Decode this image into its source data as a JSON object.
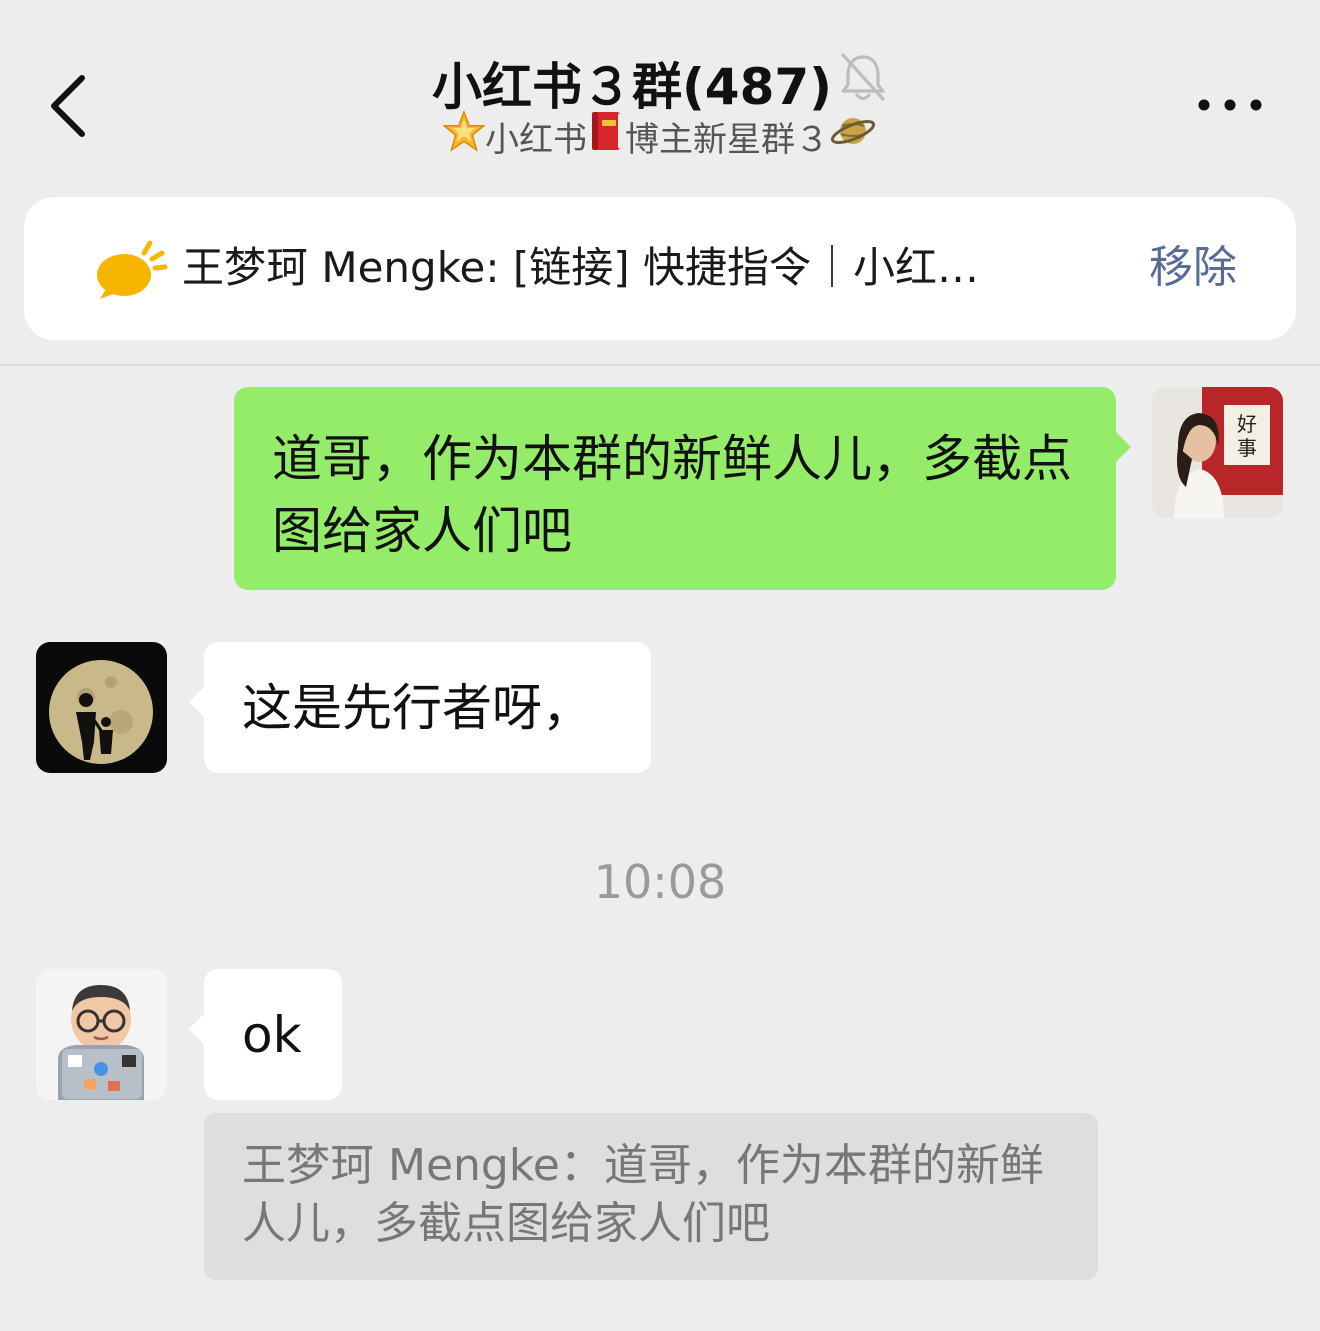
{
  "header": {
    "back_icon": "chevron-left-icon",
    "title": "小红书３群(487)",
    "muted_icon": "bell-slash-icon",
    "subtitle": "小红书",
    "subtitle_rest": "博主新星群３",
    "subtitle_icons": [
      "star-emoji-icon",
      "red-book-emoji-icon",
      "planet-emoji-icon"
    ],
    "more_icon": "ellipsis-icon"
  },
  "pinned": {
    "icon": "announcement-bubble-icon",
    "text": "王梦珂 Mengke: [链接] 快捷指令｜小红…",
    "remove_label": "移除"
  },
  "messages": [
    {
      "side": "right",
      "text": "道哥，作为本群的新鲜人儿，多截点图给家人们吧",
      "bubble_color": "#95ec69"
    },
    {
      "side": "left",
      "text": "这是先行者呀，",
      "bubble_color": "#ffffff"
    },
    {
      "side": "left",
      "text": "ok",
      "bubble_color": "#ffffff",
      "quote": "王梦珂 Mengke：道哥，作为本群的新鲜人儿，多截点图给家人们吧"
    }
  ],
  "timestamp": "10:08",
  "colors": {
    "background": "#ededed",
    "accent_link": "#576b95",
    "self_bubble": "#95ec69"
  }
}
